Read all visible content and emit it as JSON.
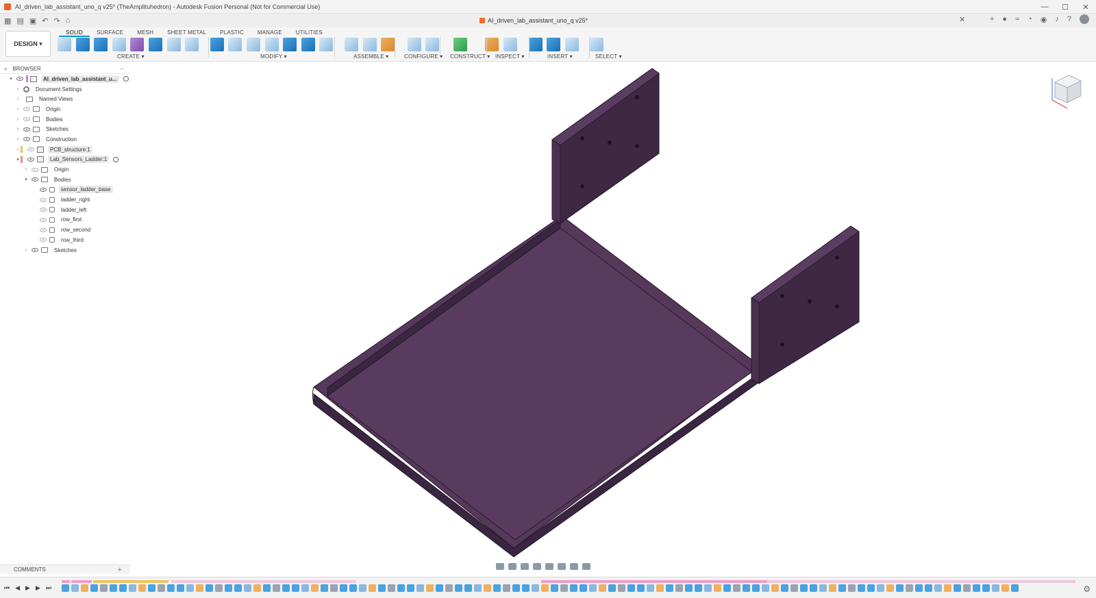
{
  "window": {
    "title": "AI_driven_lab_assistant_uno_q v25* (TheAmplituhedron) - Autodesk Fusion Personal (Not for Commercial Use)",
    "controls": [
      "—",
      "☐",
      "✕"
    ]
  },
  "document_tab": {
    "label": "AI_driven_lab_assistant_uno_q v25*",
    "close": "✕"
  },
  "workspace": {
    "design_label": "DESIGN ▾"
  },
  "ribbon": {
    "tabs": [
      "SOLID",
      "SURFACE",
      "MESH",
      "SHEET METAL",
      "PLASTIC",
      "MANAGE",
      "UTILITIES"
    ],
    "groups": [
      "CREATE ▾",
      "MODIFY ▾",
      "ASSEMBLE ▾",
      "CONFIGURE ▾",
      "CONSTRUCT ▾",
      "INSPECT ▾",
      "INSERT ▾",
      "SELECT ▾"
    ]
  },
  "browser": {
    "header": "BROWSER",
    "collapse_glyph": "«",
    "minus_glyph": "–",
    "root": "AI_driven_lab_assistant_u...",
    "items": {
      "document_settings": "Document Settings",
      "named_views": "Named Views",
      "origin": "Origin",
      "bodies": "Bodies",
      "sketches": "Sketches",
      "construction": "Construction",
      "pcb_structure": "PCB_structure:1",
      "lab_sensors_ladder": "Lab_Sensors_Ladder:1",
      "sub_origin": "Origin",
      "sub_bodies": "Bodies",
      "body_1": "sensor_ladder_base",
      "body_2": "ladder_right",
      "body_3": "ladder_left",
      "body_4": "row_first",
      "body_5": "row_second",
      "body_6": "row_third",
      "sub_sketches": "Sketches"
    }
  },
  "comments": {
    "label": "COMMENTS",
    "add": "+"
  },
  "timeline": {
    "controls": [
      "⏮",
      "◀",
      "▶",
      "▶",
      "⏭"
    ],
    "settings": "⚙"
  },
  "colors": {
    "model_top": "#55385a",
    "model_side": "#3e2844",
    "model_edge": "#2a1b2e",
    "accent": "#0696d7"
  }
}
